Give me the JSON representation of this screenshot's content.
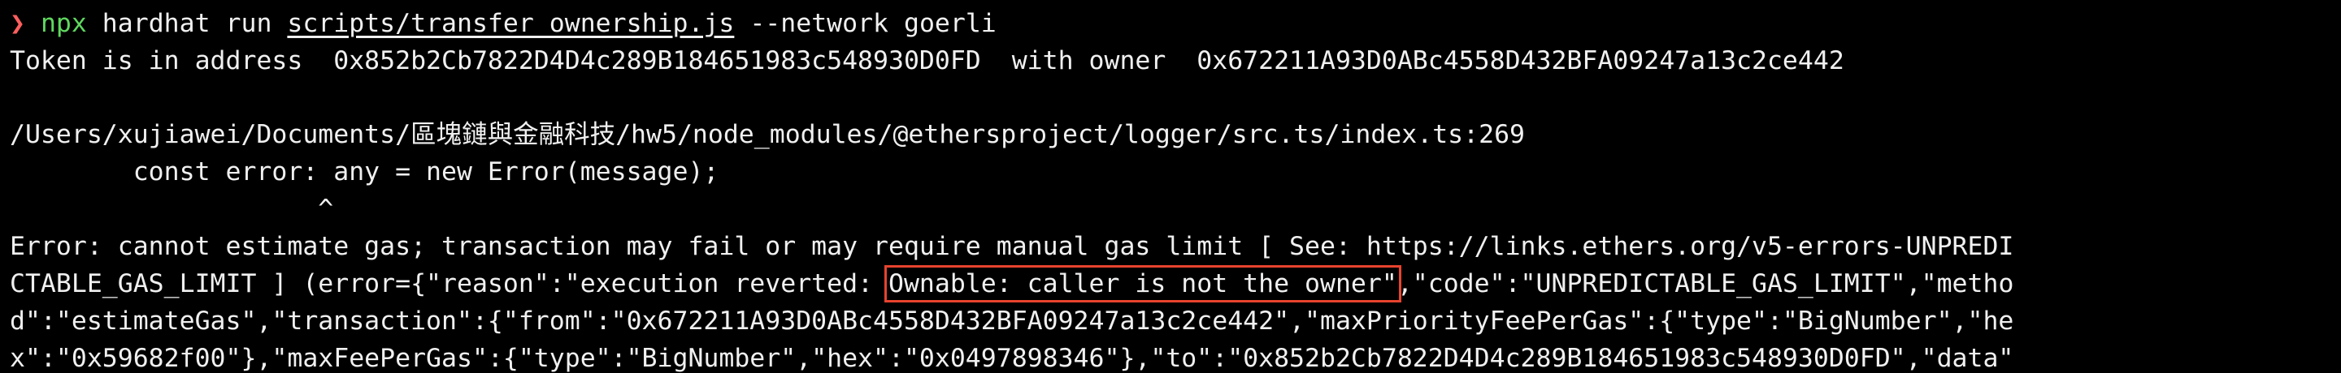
{
  "terminal": {
    "prompt": {
      "arrow": "❯",
      "command": "npx",
      "args_before": " hardhat run ",
      "script_path": "scripts/transfer_ownership.js",
      "args_after": " --network goerli"
    },
    "token_line": "Token is in address  0x852b2Cb7822D4D4c289B184651983c548930D0FD  with owner  0x672211A93D0ABc4558D432BFA09247a13c2ce442",
    "source_path": "/Users/xujiawei/Documents/區塊鏈與金融科技/hw5/node_modules/@ethersproject/logger/src.ts/index.ts:269",
    "source_code": "        const error: any = new Error(message);",
    "caret": "                    ^",
    "error_line_1": "Error: cannot estimate gas; transaction may fail or may require manual gas limit [ See: https://links.ethers.org/v5-errors-UNPREDI",
    "error_line_2_before": "CTABLE_GAS_LIMIT ] (error={\"reason\":\"execution reverted: ",
    "error_line_2_highlight": "Ownable: caller is not the owner\"",
    "error_line_2_after": ",\"code\":\"UNPREDICTABLE_GAS_LIMIT\",\"metho",
    "error_line_3": "d\":\"estimateGas\",\"transaction\":{\"from\":\"0x672211A93D0ABc4558D432BFA09247a13c2ce442\",\"maxPriorityFeePerGas\":{\"type\":\"BigNumber\",\"he",
    "error_line_4": "x\":\"0x59682f00\"},\"maxFeePerGas\":{\"type\":\"BigNumber\",\"hex\":\"0x0497898346\"},\"to\":\"0x852b2Cb7822D4D4c289B184651983c548930D0FD\",\"data\""
  },
  "colors": {
    "background": "#000000",
    "text": "#f0f0f0",
    "prompt_arrow": "#ff5f5f",
    "npx": "#5fd75f",
    "highlight_border": "#e8432e"
  }
}
